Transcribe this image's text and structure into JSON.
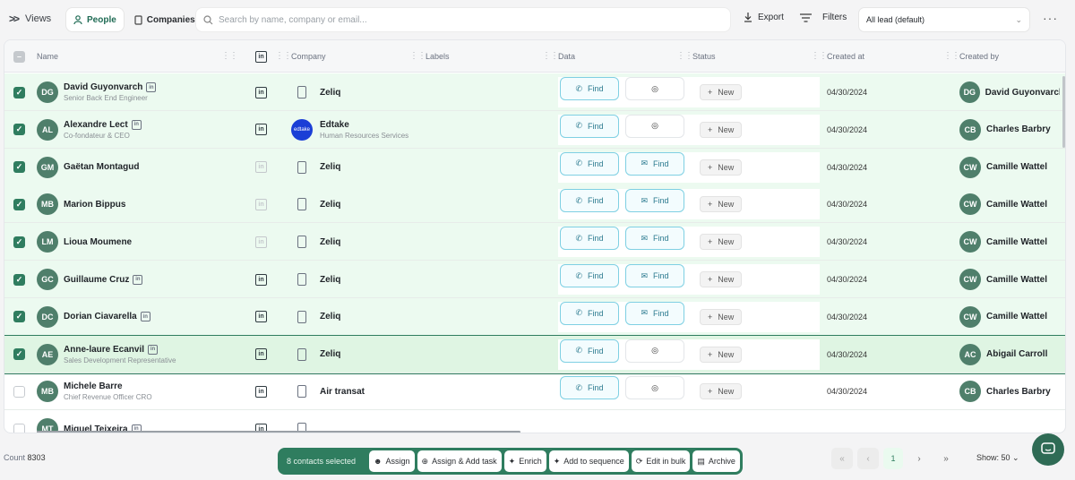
{
  "toolbar": {
    "views_label": "Views",
    "tabs": [
      {
        "label": "People"
      },
      {
        "label": "Companies"
      }
    ],
    "search_placeholder": "Search by name, company or email...",
    "export_label": "Export",
    "filters_label": "Filters",
    "view_select": "All lead (default)",
    "more": "···"
  },
  "columns": {
    "name": "Name",
    "company": "Company",
    "labels": "Labels",
    "data": "Data",
    "status": "Status",
    "created_at": "Created at",
    "created_by": "Created by"
  },
  "rows": [
    {
      "initials": "DG",
      "name": "David Guyonvarch",
      "subtitle": "Senior Back End Engineer",
      "company": "Zeliq",
      "company_sub": "",
      "phone": "Find",
      "email": "",
      "status": "New",
      "created_at": "04/30/2024",
      "creator_initials": "DG",
      "creator": "David Guyonvarch"
    },
    {
      "initials": "AL",
      "name": "Alexandre Lect",
      "subtitle": "Co-fondateur & CEO",
      "company": "Edtake",
      "company_sub": "Human Resources Services",
      "company_logo": "edtake",
      "phone": "Find",
      "email": "",
      "status": "New",
      "created_at": "04/30/2024",
      "creator_initials": "CB",
      "creator": "Charles Barbry"
    },
    {
      "initials": "GM",
      "name": "Gaëtan Montagud",
      "subtitle": "",
      "company": "Zeliq",
      "company_sub": "",
      "phone": "Find",
      "email": "Find",
      "status": "New",
      "created_at": "04/30/2024",
      "creator_initials": "CW",
      "creator": "Camille Wattel"
    },
    {
      "initials": "MB",
      "name": "Marion Bippus",
      "subtitle": "",
      "company": "Zeliq",
      "company_sub": "",
      "phone": "Find",
      "email": "Find",
      "status": "New",
      "created_at": "04/30/2024",
      "creator_initials": "CW",
      "creator": "Camille Wattel"
    },
    {
      "initials": "LM",
      "name": "Lioua Moumene",
      "subtitle": "",
      "company": "Zeliq",
      "company_sub": "",
      "phone": "Find",
      "email": "Find",
      "status": "New",
      "created_at": "04/30/2024",
      "creator_initials": "CW",
      "creator": "Camille Wattel"
    },
    {
      "initials": "GC",
      "name": "Guillaume Cruz",
      "subtitle": "",
      "company": "Zeliq",
      "company_sub": "",
      "phone": "Find",
      "email": "Find",
      "status": "New",
      "created_at": "04/30/2024",
      "creator_initials": "CW",
      "creator": "Camille Wattel"
    },
    {
      "initials": "DC",
      "name": "Dorian Ciavarella",
      "subtitle": "",
      "company": "Zeliq",
      "company_sub": "",
      "phone": "Find",
      "email": "Find",
      "status": "New",
      "created_at": "04/30/2024",
      "creator_initials": "CW",
      "creator": "Camille Wattel"
    },
    {
      "initials": "AE",
      "name": "Anne-laure Ecanvil",
      "subtitle": "Sales Development Representative",
      "company": "Zeliq",
      "company_sub": "",
      "phone": "Find",
      "email": "",
      "status": "New",
      "created_at": "04/30/2024",
      "creator_initials": "AC",
      "creator": "Abigail Carroll"
    },
    {
      "initials": "MB",
      "name": "Michele Barre",
      "subtitle": "Chief Revenue Officer CRO",
      "company": "Air transat",
      "company_sub": "",
      "phone": "Find",
      "email": "",
      "status": "New",
      "created_at": "04/30/2024",
      "creator_initials": "CB",
      "creator": "Charles Barbry"
    },
    {
      "initials": "MT",
      "name": "Miguel Teixeira",
      "subtitle": "",
      "company": "",
      "company_sub": "",
      "phone": "",
      "email": "",
      "status": "",
      "created_at": "",
      "creator_initials": "",
      "creator": ""
    }
  ],
  "footer": {
    "count_label": "Count",
    "count_value": "8303",
    "selected": "8 contacts selected",
    "actions": [
      "Assign",
      "Assign & Add task",
      "Enrich",
      "Add to sequence",
      "Edit in bulk",
      "Archive"
    ],
    "page": "1",
    "show": "Show: 50"
  },
  "colors": {
    "accent": "#2f7d5f",
    "selected_row": "#ecfaf0",
    "find_border": "#7fd0e3"
  }
}
